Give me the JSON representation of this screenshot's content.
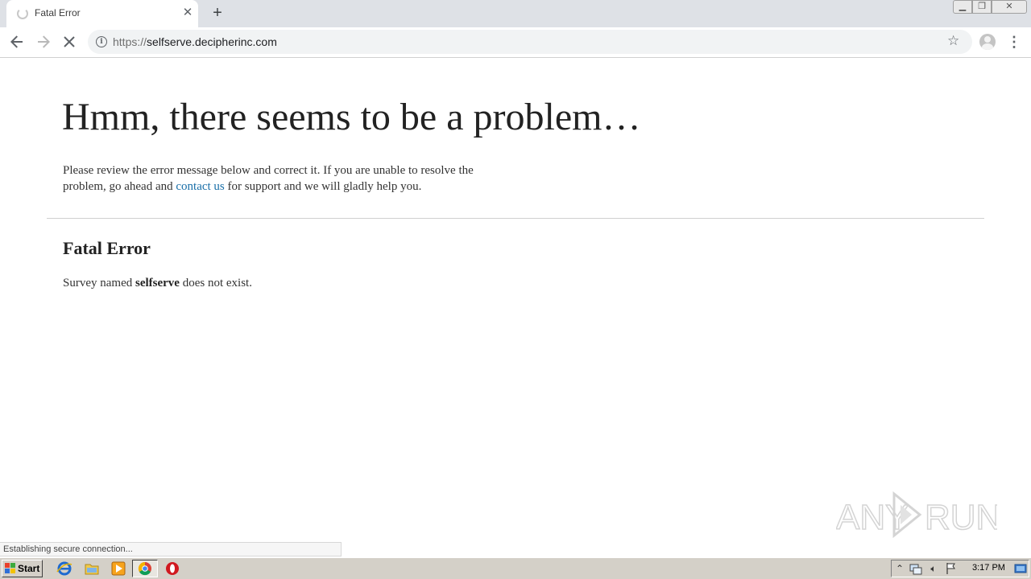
{
  "browser": {
    "tab_title": "Fatal Error",
    "tab_close": "✕",
    "new_tab": "+",
    "url_scheme": "https://",
    "url_host": "selfserve.decipherinc.com",
    "status_text": "Establishing secure connection..."
  },
  "page": {
    "headline": "Hmm, there seems to be a problem…",
    "intro_before": "Please review the error message below and correct it. If you are unable to resolve the problem, go ahead and ",
    "intro_link": "contact us",
    "intro_after": " for support and we will gladly help you.",
    "error_title": "Fatal Error",
    "error_before": "Survey named ",
    "error_name": "selfserve",
    "error_after": " does not exist."
  },
  "watermark": {
    "text": "ANY RUN"
  },
  "taskbar": {
    "start_label": "Start",
    "clock": "3:17 PM"
  },
  "icons": [
    "loading-spinner-icon",
    "close-icon",
    "plus-icon",
    "back-arrow-icon",
    "forward-arrow-icon",
    "stop-icon",
    "info-icon",
    "star-icon",
    "profile-avatar-icon",
    "kebab-menu-icon",
    "windows-logo-icon",
    "ie-icon",
    "folder-icon",
    "media-player-icon",
    "chrome-icon",
    "opera-icon",
    "network-icon",
    "volume-icon",
    "flag-icon",
    "show-desktop-icon"
  ],
  "colors": {
    "link": "#1a6fa8",
    "tabstrip": "#dee1e6",
    "taskbar": "#d4d0c8"
  }
}
